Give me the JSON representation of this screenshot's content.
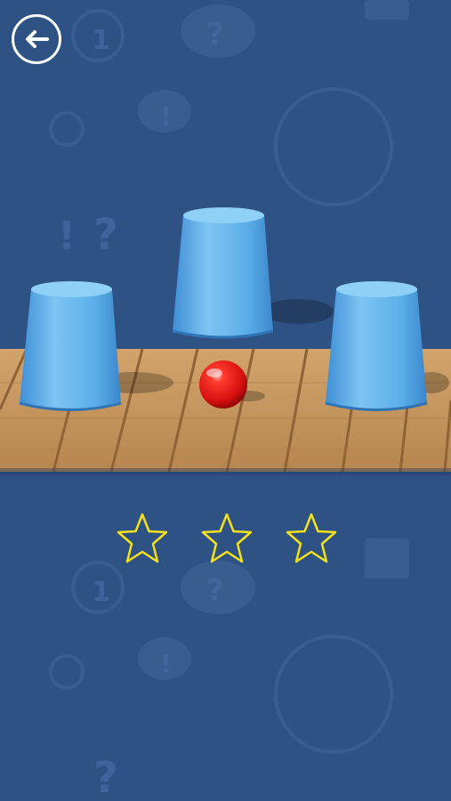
{
  "back_button": {
    "icon": "arrow-left-icon"
  },
  "game": {
    "cups": [
      {
        "name": "cup-left"
      },
      {
        "name": "cup-middle"
      },
      {
        "name": "cup-right"
      }
    ],
    "ball": {
      "color": "#e41616"
    },
    "cup_color": "#5aaee8",
    "table_color": "#c89a63"
  },
  "rating": {
    "stars_earned": 0,
    "stars_total": 3,
    "star_outline_color": "#f5e21b"
  }
}
